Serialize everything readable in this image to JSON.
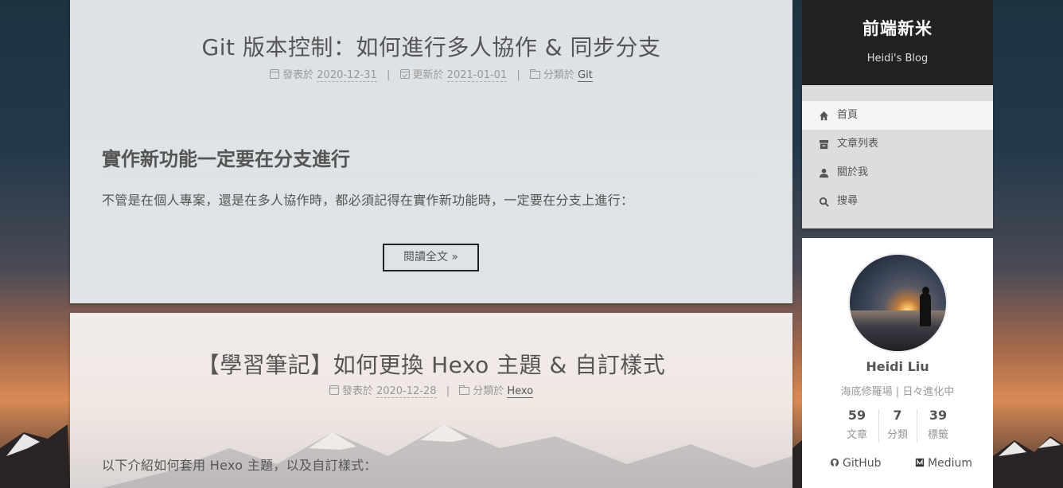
{
  "posts": [
    {
      "title": "Git 版本控制：如何進行多人協作 & 同步分支",
      "meta": {
        "published_label": "發表於",
        "published_date": "2020-12-31",
        "updated_label": "更新於",
        "updated_date": "2021-01-01",
        "category_label": "分類於",
        "category": "Git",
        "separator": "|"
      },
      "heading": "實作新功能一定要在分支進行",
      "excerpt": "不管是在個人專案，還是在多人協作時，都必須記得在實作新功能時，一定要在分支上進行：",
      "read_more": "閱讀全文 »"
    },
    {
      "title": "【學習筆記】如何更換 Hexo 主題 & 自訂樣式",
      "meta": {
        "published_label": "發表於",
        "published_date": "2020-12-28",
        "category_label": "分類於",
        "category": "Hexo",
        "separator": "|"
      },
      "excerpt": "以下介紹如何套用 Hexo 主題，以及自訂樣式："
    }
  ],
  "sidebar": {
    "brand": {
      "title": "前端新米",
      "subtitle": "Heidi's Blog"
    },
    "menu": [
      {
        "label": "首頁",
        "icon": "home-icon",
        "active": true
      },
      {
        "label": "文章列表",
        "icon": "archive-icon",
        "active": false
      },
      {
        "label": "關於我",
        "icon": "user-icon",
        "active": false
      },
      {
        "label": "搜尋",
        "icon": "search-icon",
        "active": false
      }
    ],
    "profile": {
      "name": "Heidi Liu",
      "description": "海底修羅場 | 日々進化中",
      "stats": [
        {
          "value": "59",
          "label": "文章"
        },
        {
          "value": "7",
          "label": "分類"
        },
        {
          "value": "39",
          "label": "標籤"
        }
      ],
      "links": [
        {
          "label": "GitHub",
          "icon": "github-icon"
        },
        {
          "label": "Medium",
          "icon": "medium-icon"
        }
      ]
    }
  },
  "colors": {
    "brand_bg": "#222222",
    "text": "#555555",
    "muted": "#999999"
  }
}
